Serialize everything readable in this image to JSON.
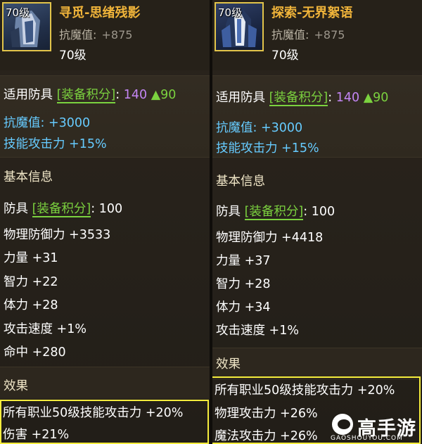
{
  "left": {
    "level_badge": "70级",
    "name": "寻觅-思绪残影",
    "sub_stat_label": "抗魔值:",
    "sub_stat_value": "+875",
    "req_level": "70级",
    "slot_label": "适用防具",
    "score_tag": "[装备积分]",
    "score_colon": ":",
    "score_value": "140",
    "score_diff": "▲90",
    "bonus1": "抗魔值: +3000",
    "bonus2": "技能攻击力 +15%",
    "basic_title": "基本信息",
    "armor_label": "防具",
    "armor_tag": "[装备积分]",
    "armor_value": ": 100",
    "stats": [
      "物理防御力 +3533",
      "力量 +31",
      "智力 +22",
      "体力 +28",
      "攻击速度 +1%",
      "命中 +280"
    ],
    "effect_title": "效果",
    "effects": [
      "所有职业50级技能攻击力 +20%",
      "伤害 +21%"
    ]
  },
  "right": {
    "level_badge": "70级",
    "name": "探索-无界絮语",
    "sub_stat_label": "抗魔值:",
    "sub_stat_value": "+875",
    "req_level": "70级",
    "slot_label": "适用防具",
    "score_tag": "[装备积分]",
    "score_colon": ":",
    "score_value": "140",
    "score_diff": "▲90",
    "bonus1": "抗魔值: +3000",
    "bonus2": "技能攻击力 +15%",
    "basic_title": "基本信息",
    "armor_label": "防具",
    "armor_tag": "[装备积分]",
    "armor_value": ": 100",
    "stats": [
      "物理防御力 +4418",
      "力量 +37",
      "智力 +28",
      "体力 +34",
      "攻击速度 +1%"
    ],
    "effect_title": "效果",
    "effects": [
      "所有职业50级技能攻击力 +20%",
      "物理攻击力 +26%",
      "魔法攻击力 +26%"
    ]
  },
  "watermark": {
    "brand": "高手游",
    "url": "GAOSHOUYOU.COM"
  },
  "colors": {
    "item_name": "#f0b43a",
    "cyan_stat": "#66cbff",
    "score_purple": "#c486f5",
    "tag_green": "#7bd23f",
    "highlight_box": "#f4ec3c"
  }
}
